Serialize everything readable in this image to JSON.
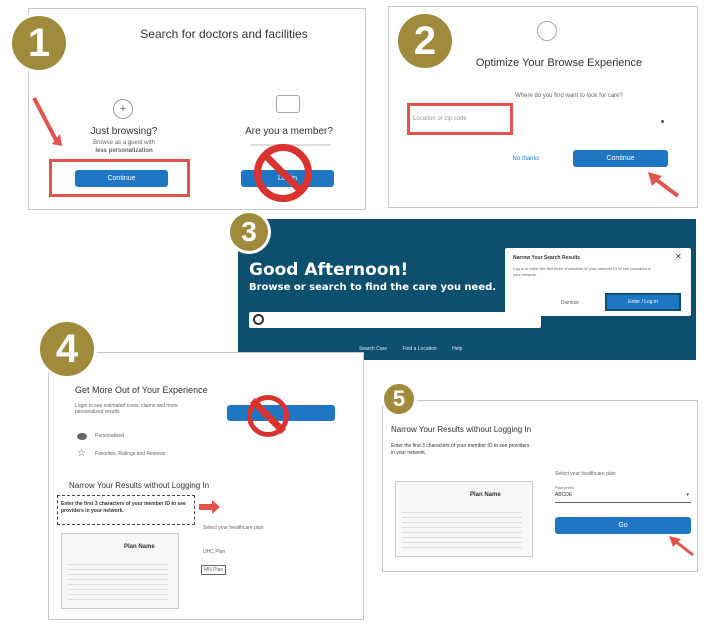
{
  "steps": {
    "s1": {
      "number": "1",
      "title": "Search for doctors and facilities",
      "option_a": {
        "title": "Just browsing?",
        "line1": "Browse as a guest with",
        "line2": "less personalization",
        "button": "Continue"
      },
      "option_b": {
        "title": "Are you a member?",
        "button": "Log in"
      }
    },
    "s2": {
      "number": "2",
      "title": "Optimize Your Browse Experience",
      "question": "Where do you find want to look for care?",
      "input_value": "Location or zip code",
      "skip": "No thanks",
      "button": "Continue"
    },
    "s3": {
      "number": "3",
      "greeting": "Good Afternoon!",
      "subtitle": "Browse or search to find the care you need.",
      "popup_title": "Narrow Your Search Results",
      "popup_text": "Log in or enter the first three characters of your member ID to see providers in your network.",
      "popup_skip": "Dismiss",
      "popup_button": "Enter / Log in",
      "close": "✕",
      "nav": [
        "Search Care",
        "Find a Location",
        "Help"
      ]
    },
    "s4": {
      "number": "4",
      "title": "Get More Out of Your Experience",
      "login_text": "Login to see estimated costs, claims and more personalized results",
      "option1": "Personalized",
      "option2": "Favorites, Ratings and Reviews",
      "narrow_title": "Narrow Your Results without Logging In",
      "narrow_text": "Enter the first 3 characters of your member ID to see providers in your network.",
      "plan_name": "Plan Name",
      "plan_label": "Select your healthcare plan",
      "plan_opt1": "UHC Plan",
      "plan_opt2": "MN Plan"
    },
    "s5": {
      "number": "5",
      "title": "Narrow Your Results without Logging In",
      "text": "Enter the first 3 characters of your member ID to see providers in your network.",
      "plan_name": "Plan Name",
      "plan_label": "Select your healthcare plan",
      "select_label": "Plan prefix",
      "select_value": "ABCDE",
      "button": "Go"
    }
  },
  "colors": {
    "badge": "#a08a3c",
    "button_blue": "#1f77c3",
    "highlight_red": "#e2554f",
    "header_dark": "#0e4f6e"
  }
}
